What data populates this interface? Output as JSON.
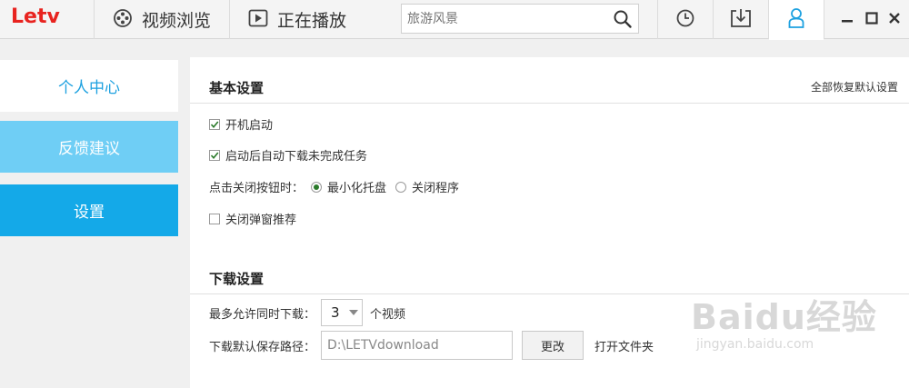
{
  "app": {
    "logo": "Letv",
    "brand_color": "#e8231f",
    "accent_color": "#1da1e0"
  },
  "nav": {
    "browse_label": "视频浏览",
    "playing_label": "正在播放",
    "browse_icon": "film-reel-icon",
    "playing_icon": "play-icon"
  },
  "search": {
    "placeholder": "旅游风景",
    "value": ""
  },
  "toolbar_icons": [
    "history-clock-icon",
    "download-icon",
    "user-icon",
    "minimize-icon",
    "maximize-icon",
    "close-icon"
  ],
  "sidebar": {
    "items": [
      {
        "label": "个人中心",
        "state": "normal"
      },
      {
        "label": "反馈建议",
        "state": "hover"
      },
      {
        "label": "设置",
        "state": "selected"
      }
    ]
  },
  "basic": {
    "title": "基本设置",
    "reset_label": "全部恢复默认设置",
    "startup_label": "开机启动",
    "startup_checked": true,
    "autodl_label": "启动后自动下载未完成任务",
    "autodl_checked": true,
    "close_prompt": "点击关闭按钮时：",
    "close_options": [
      {
        "label": "最小化托盘",
        "selected": true
      },
      {
        "label": "关闭程序",
        "selected": false
      }
    ],
    "popup_label": "关闭弹窗推荐",
    "popup_checked": false
  },
  "download": {
    "title": "下载设置",
    "max_label": "最多允许同时下载：",
    "max_value": "3",
    "max_unit": "个视频",
    "path_label": "下载默认保存路径：",
    "path_value": "D:\\LETVdownload",
    "change_button": "更改",
    "open_folder": "打开文件夹"
  },
  "watermark": {
    "line1": "Baidu经验",
    "line2": "jingyan.baidu.com"
  }
}
